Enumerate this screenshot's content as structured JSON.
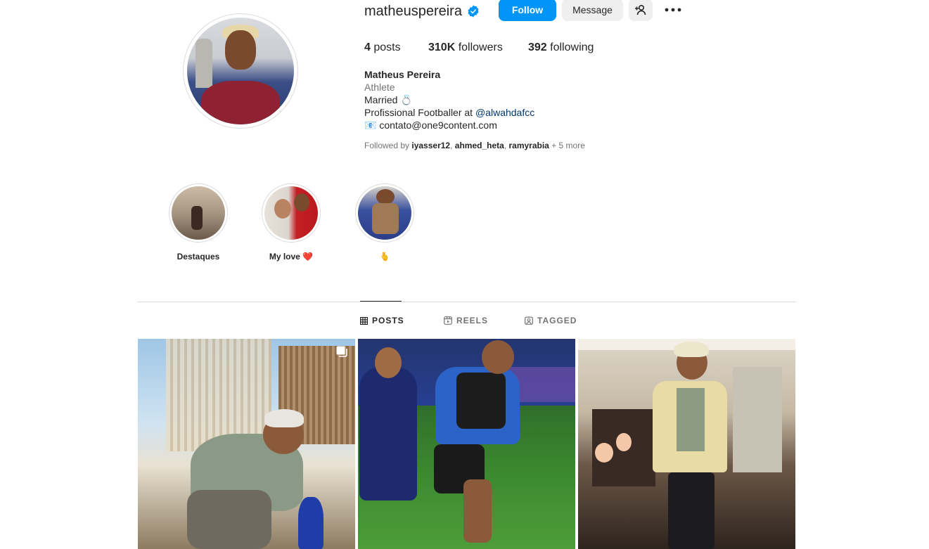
{
  "profile": {
    "username": "matheuspereira",
    "follow_label": "Follow",
    "message_label": "Message",
    "stats": {
      "posts_count": "4",
      "posts_label": "posts",
      "followers_count": "310K",
      "followers_label": "followers",
      "following_count": "392",
      "following_label": "following"
    },
    "bio": {
      "name": "Matheus Pereira",
      "category": "Athlete",
      "married": "Married 💍",
      "job_prefix": "Profissional Footballer at ",
      "job_link": "@alwahdafcc",
      "email_emoji": "📧",
      "email": "contato@one9content.com"
    },
    "followed_by": {
      "prefix": "Followed by ",
      "users": [
        "iyasser12",
        "ahmed_heta",
        "ramyrabia"
      ],
      "more": "+ 5 more"
    }
  },
  "highlights": [
    {
      "label": "Destaques"
    },
    {
      "label": "My love ❤️"
    },
    {
      "label": "🫰"
    }
  ],
  "tabs": [
    {
      "label": "POSTS",
      "icon": "grid-icon",
      "active": true
    },
    {
      "label": "REELS",
      "icon": "reels-icon",
      "active": false
    },
    {
      "label": "TAGGED",
      "icon": "tagged-icon",
      "active": false
    }
  ],
  "posts": [
    {
      "icon": "carousel-icon"
    },
    {},
    {}
  ],
  "colors": {
    "accent": "#0095f6",
    "text": "#262626",
    "secondary_text": "#737373",
    "link": "#00376b"
  }
}
